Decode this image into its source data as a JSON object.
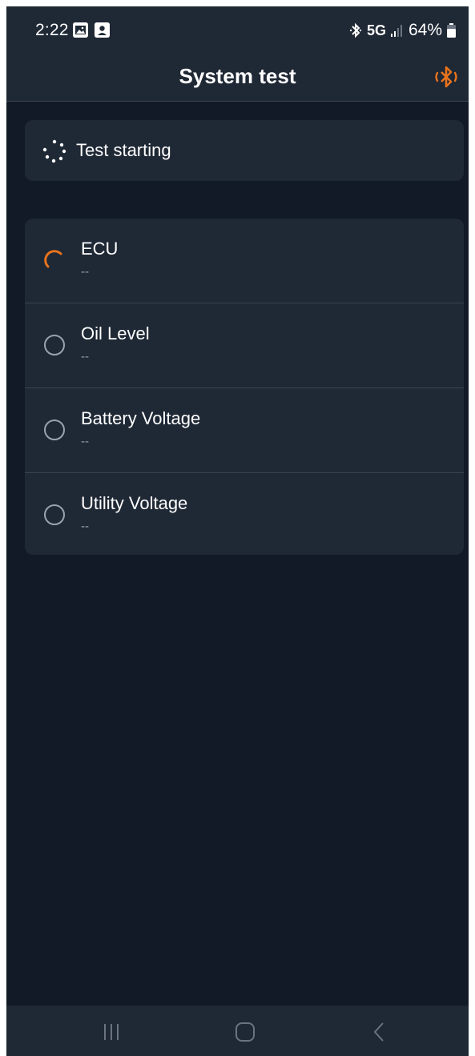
{
  "status_bar": {
    "time": "2:22",
    "network": "5G",
    "battery": "64%",
    "icons": [
      "gallery-icon",
      "person-icon",
      "bluetooth-icon",
      "signal-icon",
      "battery-icon"
    ]
  },
  "app_bar": {
    "title": "System test",
    "action_icon": "bluetooth-icon"
  },
  "status_card": {
    "icon": "spinner-icon",
    "text": "Test starting"
  },
  "tests": [
    {
      "name": "ECU",
      "value": "--",
      "state": "running",
      "icon": "progress-arc-icon"
    },
    {
      "name": "Oil Level",
      "value": "--",
      "state": "pending",
      "icon": "empty-circle-icon"
    },
    {
      "name": "Battery Voltage",
      "value": "--",
      "state": "pending",
      "icon": "empty-circle-icon"
    },
    {
      "name": "Utility Voltage",
      "value": "--",
      "state": "pending",
      "icon": "empty-circle-icon"
    }
  ],
  "nav_bar": {
    "buttons": [
      "recent-apps-icon",
      "home-icon",
      "back-icon"
    ]
  },
  "colors": {
    "background": "#121927",
    "surface": "#1f2835",
    "accent": "#e8731c",
    "text": "#ffffff",
    "muted": "#9aa3ad",
    "divider": "#3a4452"
  }
}
